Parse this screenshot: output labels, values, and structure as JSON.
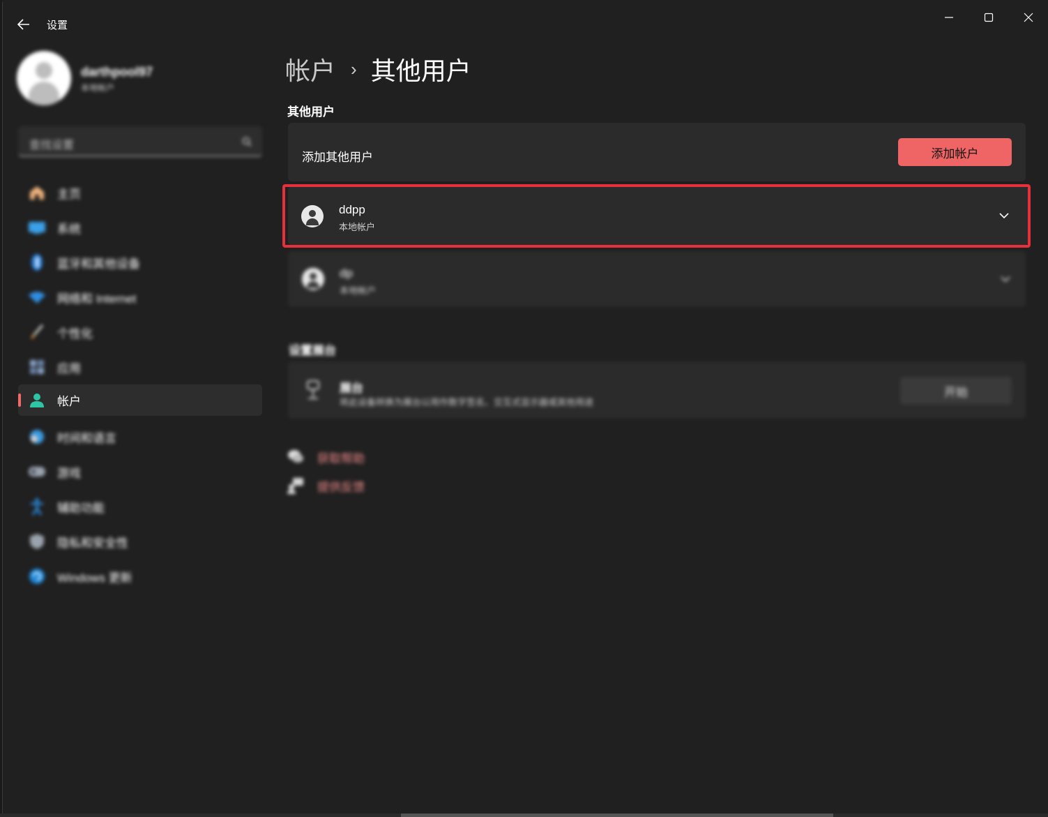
{
  "window": {
    "title": "设置",
    "controls": [
      "minimize",
      "maximize",
      "close"
    ]
  },
  "profile": {
    "name": "darthpool97",
    "account_type": "本地帐户"
  },
  "search": {
    "placeholder": "查找设置"
  },
  "sidebar": {
    "items": [
      {
        "label": "主页",
        "icon": "home-icon"
      },
      {
        "label": "系统",
        "icon": "system-icon"
      },
      {
        "label": "蓝牙和其他设备",
        "icon": "bluetooth-icon"
      },
      {
        "label": "网络和 Internet",
        "icon": "wifi-icon"
      },
      {
        "label": "个性化",
        "icon": "brush-icon"
      },
      {
        "label": "应用",
        "icon": "apps-icon"
      },
      {
        "label": "帐户",
        "icon": "account-icon",
        "active": true
      },
      {
        "label": "时间和语言",
        "icon": "globe-clock-icon"
      },
      {
        "label": "游戏",
        "icon": "gamepad-icon"
      },
      {
        "label": "辅助功能",
        "icon": "accessibility-icon"
      },
      {
        "label": "隐私和安全性",
        "icon": "shield-icon"
      },
      {
        "label": "Windows 更新",
        "icon": "update-icon"
      }
    ]
  },
  "breadcrumb": {
    "parent": "帐户",
    "separator": "›",
    "current": "其他用户"
  },
  "other_users": {
    "section_title": "其他用户",
    "add_row_label": "添加其他用户",
    "add_button": "添加帐户",
    "users": [
      {
        "name": "ddpp",
        "type": "本地帐户",
        "highlighted": true
      },
      {
        "name": "dp",
        "type": "本地帐户",
        "highlighted": false
      }
    ]
  },
  "kiosk": {
    "section_title": "设置展台",
    "title": "展台",
    "description": "将此设备转换为展台以用作数字签名、交互式显示器或其他用途",
    "button": "开始"
  },
  "links": {
    "help": "获取帮助",
    "feedback": "提供反馈"
  },
  "colors": {
    "accent": "#ef6565",
    "highlight_border": "#e6303b",
    "background": "#202020",
    "card": "#2b2b2b"
  }
}
